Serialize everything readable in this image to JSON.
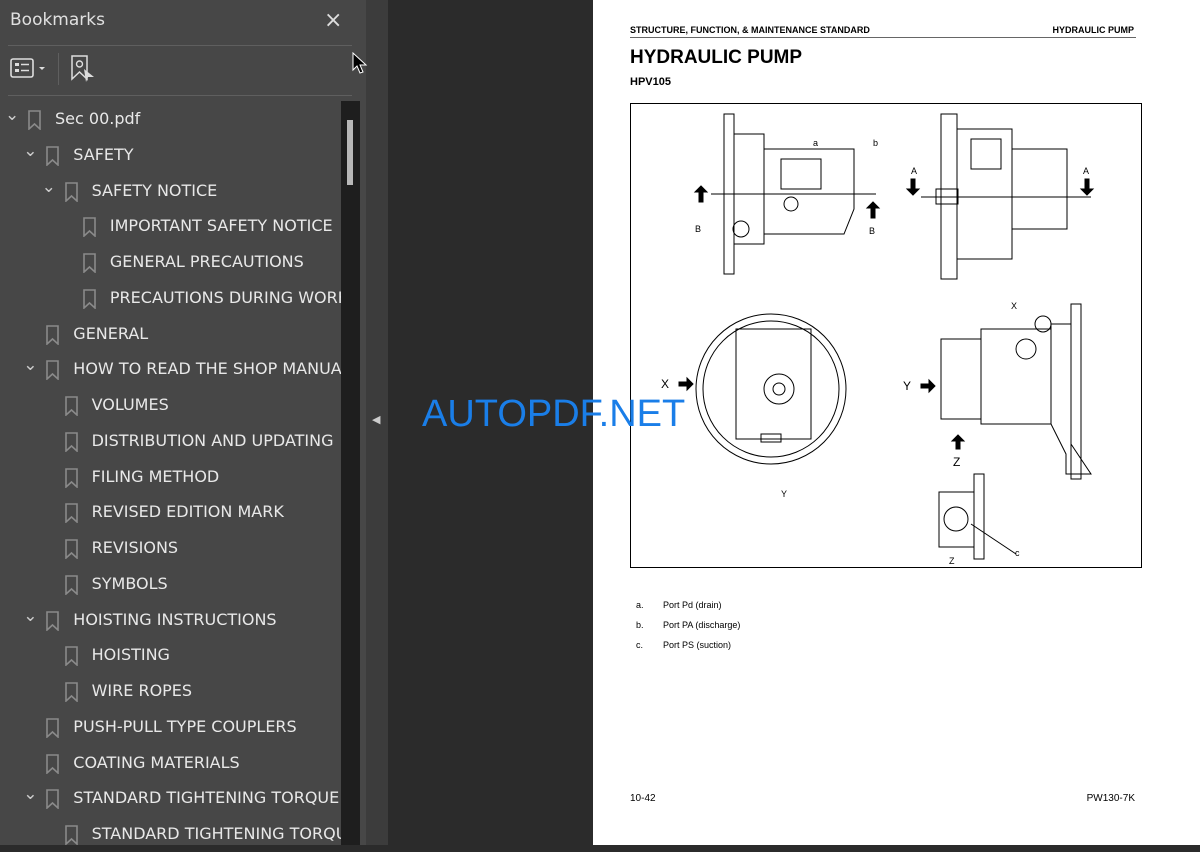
{
  "sidebar": {
    "title": "Bookmarks",
    "close_icon": "×",
    "items": [
      {
        "label": "Sec 00.pdf",
        "level": 0,
        "expanded": true
      },
      {
        "label": "SAFETY",
        "level": 1,
        "expanded": true
      },
      {
        "label": "SAFETY NOTICE",
        "level": 2,
        "expanded": true
      },
      {
        "label": "IMPORTANT SAFETY NOTICE",
        "level": 3
      },
      {
        "label": "GENERAL PRECAUTIONS",
        "level": 3
      },
      {
        "label": "PRECAUTIONS DURING WORK",
        "level": 3
      },
      {
        "label": "GENERAL",
        "level": 1
      },
      {
        "label": "HOW TO READ THE SHOP MANUAL",
        "level": 1,
        "expanded": true
      },
      {
        "label": "VOLUMES",
        "level": 2
      },
      {
        "label": "DISTRIBUTION AND UPDATING",
        "level": 2
      },
      {
        "label": "FILING METHOD",
        "level": 2
      },
      {
        "label": "REVISED EDITION MARK",
        "level": 2
      },
      {
        "label": "REVISIONS",
        "level": 2
      },
      {
        "label": "SYMBOLS",
        "level": 2
      },
      {
        "label": "HOISTING INSTRUCTIONS",
        "level": 1,
        "expanded": true
      },
      {
        "label": "HOISTING",
        "level": 2
      },
      {
        "label": "WIRE ROPES",
        "level": 2
      },
      {
        "label": "PUSH-PULL TYPE COUPLERS",
        "level": 1
      },
      {
        "label": "COATING MATERIALS",
        "level": 1
      },
      {
        "label": "STANDARD TIGHTENING TORQUE",
        "level": 1,
        "expanded": true
      },
      {
        "label": "STANDARD TIGHTENING TORQUE",
        "level": 2
      }
    ]
  },
  "page": {
    "header_left": "STRUCTURE, FUNCTION, & MAINTENANCE STANDARD",
    "header_right": "HYDRAULIC PUMP",
    "title": "HYDRAULIC PUMP",
    "model": "HPV105",
    "figure_labels": {
      "a": "a",
      "b": "b",
      "A": "A",
      "B": "B",
      "X": "X",
      "Y": "Y",
      "Z": "Z",
      "c": "c"
    },
    "legend": [
      {
        "key": "a.",
        "text": "Port Pd (drain)"
      },
      {
        "key": "b.",
        "text": "Port PA (discharge)"
      },
      {
        "key": "c.",
        "text": "Port PS (suction)"
      }
    ],
    "footer_left": "10-42",
    "footer_right": "PW130-7K"
  },
  "watermark": "AUTOPDF.NET"
}
